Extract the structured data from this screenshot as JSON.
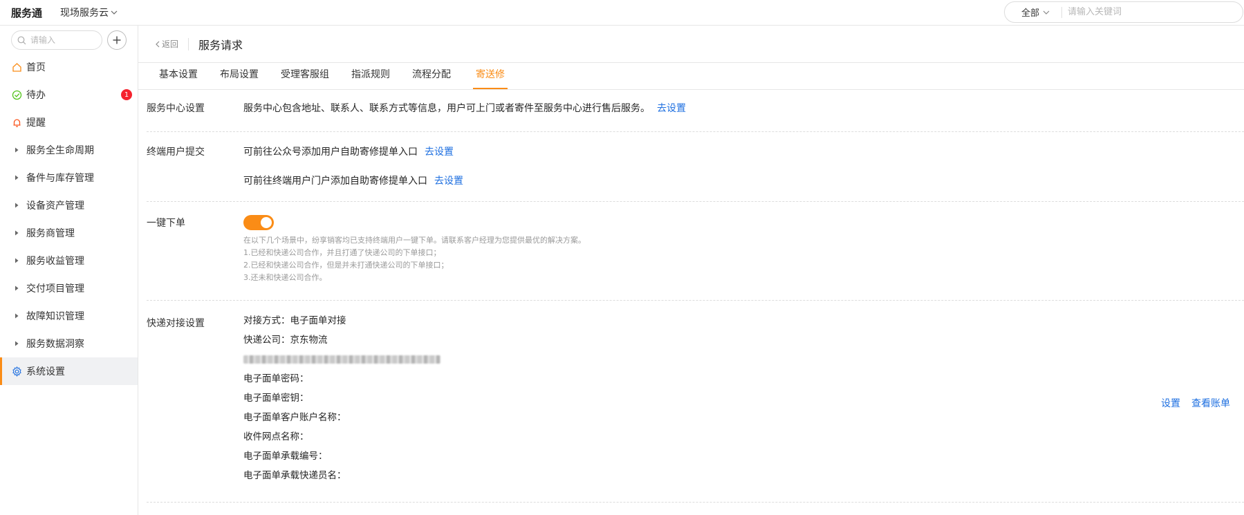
{
  "topbar": {
    "brand": "服务通",
    "app_switch": "现场服务云",
    "search_scope": "全部",
    "search_placeholder": "请输入关键词"
  },
  "sidebar": {
    "search_placeholder": "请输入",
    "items": [
      {
        "label": "首页",
        "icon": "home-icon"
      },
      {
        "label": "待办",
        "icon": "check-circle-icon",
        "badge": "1"
      },
      {
        "label": "提醒",
        "icon": "bell-icon"
      },
      {
        "label": "服务全生命周期",
        "icon": "caret-right-icon"
      },
      {
        "label": "备件与库存管理",
        "icon": "caret-right-icon"
      },
      {
        "label": "设备资产管理",
        "icon": "caret-right-icon"
      },
      {
        "label": "服务商管理",
        "icon": "caret-right-icon"
      },
      {
        "label": "服务收益管理",
        "icon": "caret-right-icon"
      },
      {
        "label": "交付项目管理",
        "icon": "caret-right-icon"
      },
      {
        "label": "故障知识管理",
        "icon": "caret-right-icon"
      },
      {
        "label": "服务数据洞察",
        "icon": "caret-right-icon"
      },
      {
        "label": "系统设置",
        "icon": "gear-icon",
        "active": true
      }
    ]
  },
  "header": {
    "back": "返回",
    "title": "服务请求"
  },
  "tabs": [
    {
      "label": "基本设置"
    },
    {
      "label": "布局设置"
    },
    {
      "label": "受理客服组"
    },
    {
      "label": "指派规则"
    },
    {
      "label": "流程分配"
    },
    {
      "label": "寄送修",
      "active": true
    }
  ],
  "sections": {
    "service_center": {
      "label": "服务中心设置",
      "desc": "服务中心包含地址、联系人、联系方式等信息，用户可上门或者寄件至服务中心进行售后服务。",
      "link": "去设置"
    },
    "end_user": {
      "label": "终端用户提交",
      "line1": "可前往公众号添加用户自助寄修提单入口",
      "line1_link": "去设置",
      "line2": "可前往终端用户门户添加自助寄修提单入口",
      "line2_link": "去设置"
    },
    "one_click": {
      "label": "一键下单",
      "enabled": true,
      "hint": [
        "在以下几个场景中，纷享销客均已支持终端用户一键下单。请联系客户经理为您提供最优的解决方案。",
        "1.已经和快递公司合作，并且打通了快递公司的下单接口；",
        "2.已经和快递公司合作，但是并未打通快递公司的下单接口；",
        "3.还未和快递公司合作。"
      ]
    },
    "express": {
      "label": "快递对接设置",
      "rows": [
        "对接方式：电子面单对接",
        "快递公司：京东物流"
      ],
      "rows_after": [
        "电子面单密码：",
        "电子面单密钥：",
        "电子面单客户账户名称：",
        "收件网点名称：",
        "电子面单承载编号：",
        "电子面单承载快递员名："
      ],
      "action_setup": "设置",
      "action_bill": "查看账单"
    }
  },
  "colors": {
    "accent": "#fa8c16",
    "link": "#1e6fe0",
    "badge": "#f5222d"
  }
}
